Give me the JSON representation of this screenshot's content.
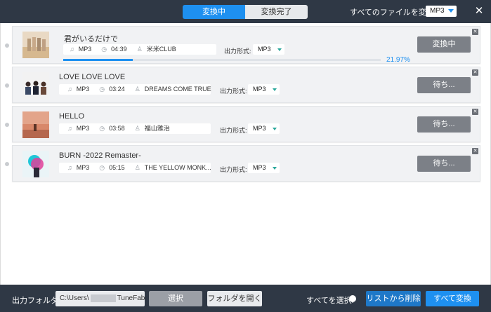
{
  "header": {
    "tab_converting": "変換中",
    "tab_done": "変換完了",
    "convert_all_label": "すべてのファイルを変換:",
    "convert_all_format": "MP3",
    "close_icon": "✕"
  },
  "rows": [
    {
      "title": "君がいるだけで",
      "format": "MP3",
      "duration": "04:39",
      "artist": "米米CLUB",
      "output_label": "出力形式:",
      "output_format": "MP3",
      "button": "変換中",
      "progress_percent": 21.97,
      "progress_text": "21.97%"
    },
    {
      "title": "LOVE LOVE LOVE",
      "format": "MP3",
      "duration": "03:24",
      "artist": "DREAMS COME TRUE",
      "output_label": "出力形式:",
      "output_format": "MP3",
      "button": "待ち..."
    },
    {
      "title": "HELLO",
      "format": "MP3",
      "duration": "03:58",
      "artist": "福山雅治",
      "output_label": "出力形式:",
      "output_format": "MP3",
      "button": "待ち..."
    },
    {
      "title": "BURN -2022 Remaster-",
      "format": "MP3",
      "duration": "05:15",
      "artist": "THE YELLOW MONK...",
      "output_label": "出力形式:",
      "output_format": "MP3",
      "button": "待ち..."
    }
  ],
  "footer": {
    "output_folder_label": "出力フォルダ:",
    "path_prefix": "C:\\Users\\",
    "path_suffix": "TuneFab\\A...",
    "select_button": "選択",
    "open_folder_button": "フォルダを開く",
    "select_all_label": "すべてを選択:",
    "remove_button": "リストから削除",
    "convert_all_button": "すべて変換"
  },
  "icons": {
    "format": "music-note-icon",
    "duration": "clock-icon",
    "artist": "person-icon",
    "remove_row": "close-icon"
  },
  "colors": {
    "accent": "#1e90f0",
    "dark_bar": "#2f3845",
    "caret": "#2aa79b"
  }
}
